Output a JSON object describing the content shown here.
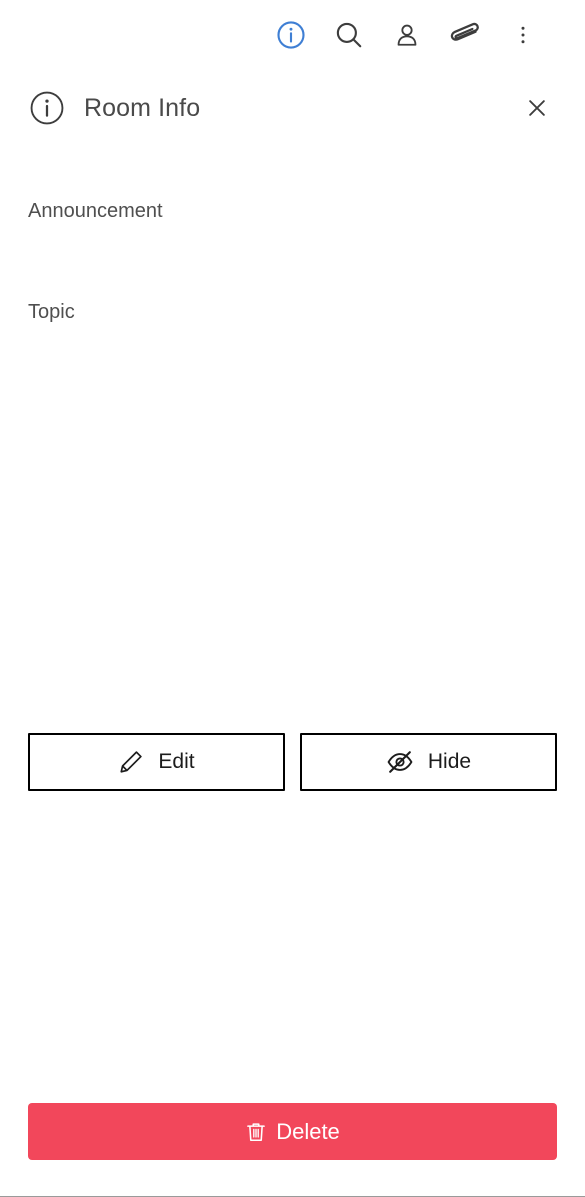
{
  "toolbar": {
    "items": [
      {
        "label": "Room Info",
        "icon": "info-circle-icon",
        "active": true
      },
      {
        "label": "Search",
        "icon": "search-icon",
        "active": false
      },
      {
        "label": "Members",
        "icon": "person-icon",
        "active": false
      },
      {
        "label": "Attachments",
        "icon": "paperclip-icon",
        "active": false
      },
      {
        "label": "More options",
        "icon": "kebab-menu-icon",
        "active": false
      }
    ]
  },
  "header": {
    "title": "Room Info",
    "icon": "info-circle-icon",
    "close_label": "Close"
  },
  "fields": [
    {
      "label": "Announcement",
      "value": ""
    },
    {
      "label": "Topic",
      "value": ""
    }
  ],
  "actions": {
    "edit_label": "Edit",
    "edit_icon": "pencil-icon",
    "hide_label": "Hide",
    "hide_icon": "eye-slash-icon"
  },
  "delete": {
    "label": "Delete",
    "icon": "trash-icon"
  },
  "colors": {
    "accent_blue": "#3f7fd4",
    "danger_red": "#F2475B",
    "text_dark": "#4a4a4a",
    "icon_dark": "#3d3d3d",
    "border_black": "#000000"
  }
}
